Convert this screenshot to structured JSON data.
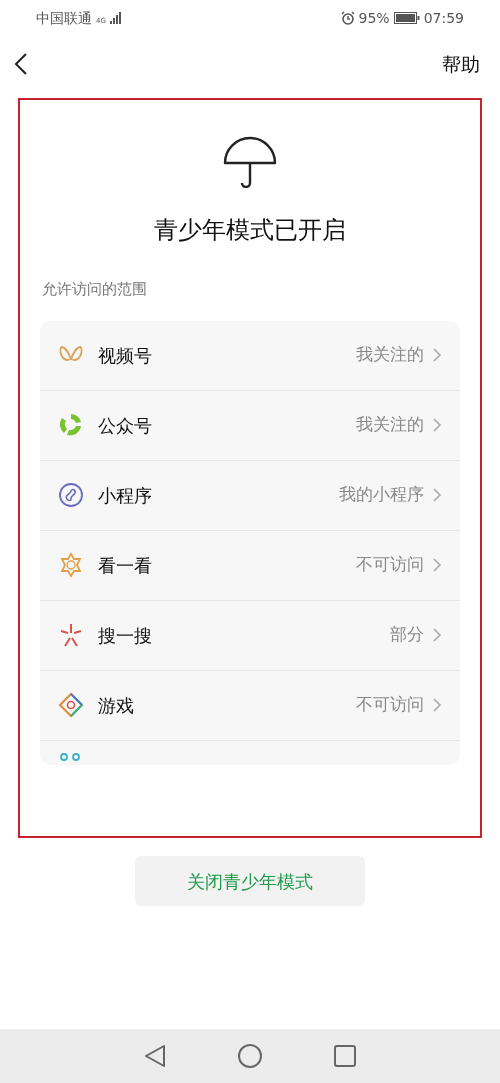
{
  "status_bar": {
    "carrier": "中国联通",
    "network": "4G",
    "battery": "95%",
    "time": "07:59"
  },
  "nav": {
    "action": "帮助"
  },
  "header": {
    "title": "青少年模式已开启"
  },
  "section": {
    "label": "允许访问的范围"
  },
  "items": [
    {
      "kind": "channels",
      "name": "视频号",
      "value": "我关注的"
    },
    {
      "kind": "official",
      "name": "公众号",
      "value": "我关注的"
    },
    {
      "kind": "miniprogram",
      "name": "小程序",
      "value": "我的小程序"
    },
    {
      "kind": "topstories",
      "name": "看一看",
      "value": "不可访问"
    },
    {
      "kind": "search",
      "name": "搜一搜",
      "value": "部分"
    },
    {
      "kind": "games",
      "name": "游戏",
      "value": "不可访问"
    },
    {
      "kind": "partial"
    }
  ],
  "button": {
    "label": "关闭青少年模式"
  }
}
